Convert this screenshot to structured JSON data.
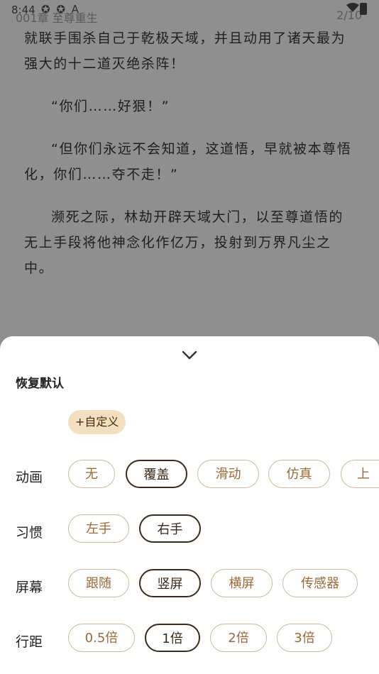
{
  "status": {
    "time": "8:44",
    "icons": "✪ ✪ A"
  },
  "header": {
    "chapter": "001章 至尊重生",
    "page": "2/10"
  },
  "reader": {
    "paragraphs": [
      "就联手围杀自己于乾极天域，并且动用了诸天最为强大的十二道灭绝杀阵！",
      "“你们……好狠！”",
      "“但你们永远不会知道，这道悟，早就被本尊悟化，你们……夺不走！”",
      "濒死之际，林劫开辟天域大门，以至尊道悟的无上手段将他神念化作亿万，投射到万界凡尘之中。"
    ]
  },
  "settings": {
    "reset_label": "恢复默认",
    "custom_label": "+自定义",
    "animation": {
      "label": "动画",
      "options": [
        "无",
        "覆盖",
        "滑动",
        "仿真",
        "上"
      ],
      "selected": "覆盖"
    },
    "habit": {
      "label": "习惯",
      "options": [
        "左手",
        "右手"
      ],
      "selected": "右手"
    },
    "screen": {
      "label": "屏幕",
      "options": [
        "跟随",
        "竖屏",
        "横屏",
        "传感器"
      ],
      "selected": "竖屏"
    },
    "spacing": {
      "label": "行距",
      "options": [
        "0.5倍",
        "1倍",
        "2倍",
        "3倍"
      ],
      "selected": "1倍"
    }
  },
  "colors": {
    "overlay": "#8f8f8f",
    "chip_border": "#cdb9a2",
    "chip_text": "#9a6a3a",
    "selected": "#3a2a1e",
    "custom_bg": "#f1dfc0"
  }
}
